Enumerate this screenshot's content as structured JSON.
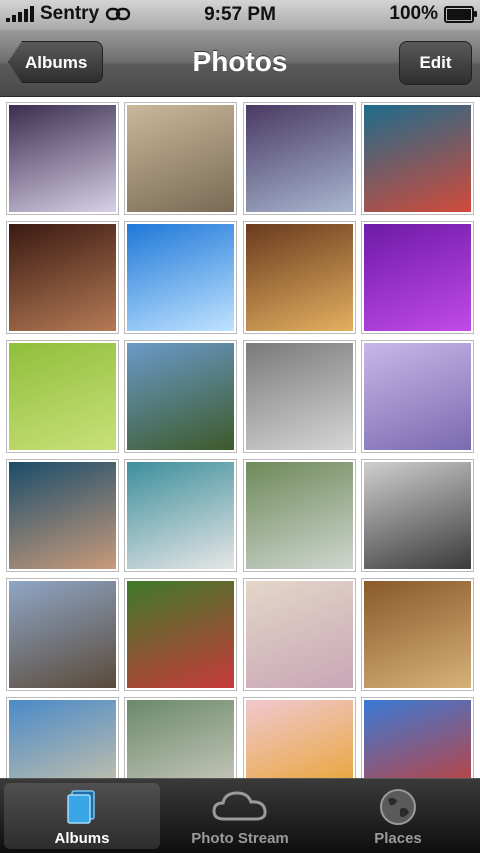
{
  "status": {
    "carrier": "Sentry",
    "time": "9:57 PM",
    "battery": "100%"
  },
  "nav": {
    "title": "Photos",
    "back_label": "Albums",
    "edit_label": "Edit"
  },
  "grid": {
    "rows": [
      [
        {
          "c1": "#3a2d4f",
          "c2": "#d8d0e8"
        },
        {
          "c1": "#c9b89a",
          "c2": "#7a6a55"
        },
        {
          "c1": "#4a3a63",
          "c2": "#a9b6d0"
        },
        {
          "c1": "#1e6c8c",
          "c2": "#d24a3a"
        }
      ],
      [
        {
          "c1": "#3a1a12",
          "c2": "#b57a55"
        },
        {
          "c1": "#1f78d8",
          "c2": "#bfe3ff"
        },
        {
          "c1": "#6a3a1e",
          "c2": "#e3b060"
        },
        {
          "c1": "#6d1aa8",
          "c2": "#c24ae8"
        }
      ],
      [
        {
          "c1": "#8fbf3a",
          "c2": "#c9e07a"
        },
        {
          "c1": "#6a9ac9",
          "c2": "#3d5a2a"
        },
        {
          "c1": "#7a7a7a",
          "c2": "#d6d6d6"
        },
        {
          "c1": "#c8b7e8",
          "c2": "#7a6ab0"
        }
      ],
      [
        {
          "c1": "#1b4d6b",
          "c2": "#c89a7a"
        },
        {
          "c1": "#3d8f9c",
          "c2": "#e6e6e6"
        },
        {
          "c1": "#6e8a5a",
          "c2": "#cfd6cf"
        },
        {
          "c1": "#cfcfcf",
          "c2": "#3a3a3a"
        }
      ],
      [
        {
          "c1": "#8fa6c6",
          "c2": "#5a4a3a"
        },
        {
          "c1": "#3d7a2a",
          "c2": "#c83a3a"
        },
        {
          "c1": "#e3d6c8",
          "c2": "#c9a6b6"
        },
        {
          "c1": "#8a5a2a",
          "c2": "#d6b07a"
        }
      ],
      [
        {
          "c1": "#4a8ac9",
          "c2": "#d6c8a6"
        },
        {
          "c1": "#6a8a6a",
          "c2": "#d6d0c6"
        },
        {
          "c1": "#f0c8d0",
          "c2": "#e8a020"
        },
        {
          "c1": "#3a7ad6",
          "c2": "#d23a2a"
        }
      ]
    ]
  },
  "tabs": [
    {
      "label": "Albums",
      "icon": "albums-icon"
    },
    {
      "label": "Photo Stream",
      "icon": "cloud-icon"
    },
    {
      "label": "Places",
      "icon": "globe-icon"
    }
  ],
  "colors": {
    "active_tab": "#ffffff",
    "inactive_tab": "#9a9a9a",
    "albums_icon": "#3aa6e8"
  }
}
